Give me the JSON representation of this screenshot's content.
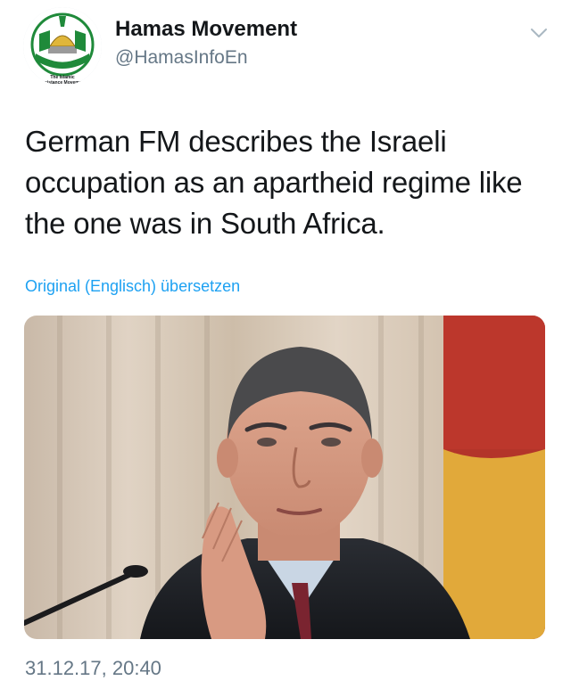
{
  "account": {
    "display_name": "Hamas Movement",
    "handle": "@HamasInfoEn",
    "avatar_text": [
      "The Islamic",
      "Resistance Movement"
    ]
  },
  "tweet": {
    "text_lines": [
      "German FM describes the Israeli",
      "occupation as an apartheid regime like",
      "the one was in South Africa."
    ],
    "translate_label": "Original (Englisch) übersetzen",
    "timestamp": "31.12.17, 20:40"
  },
  "media": {
    "kind": "photo",
    "description_icon": "photo-of-speaker-at-microphone"
  },
  "icons": {
    "menu": "chevron-down-icon",
    "avatar": "hamas-logo"
  },
  "colors": {
    "link": "#1da1f2",
    "secondary_text": "#657786",
    "primary_text": "#14171a",
    "logo_green": "#1f8a3a"
  }
}
